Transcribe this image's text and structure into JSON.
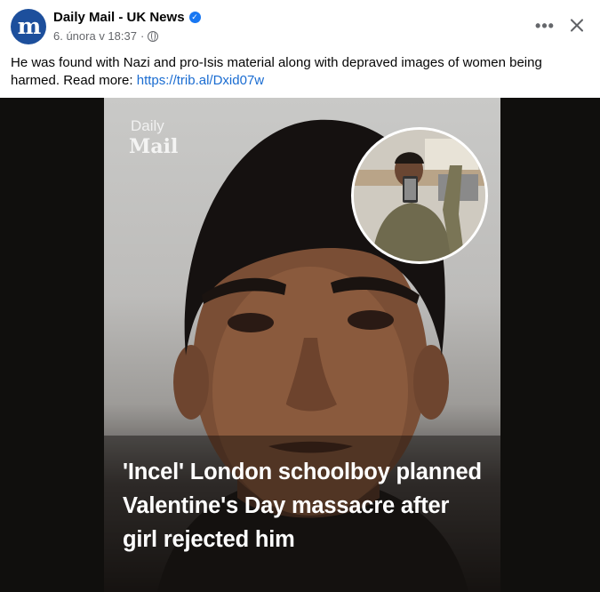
{
  "post": {
    "page_name": "Daily Mail - UK News",
    "avatar_letter": "m",
    "verified_symbol": "✓",
    "date": "6. února v 18:37",
    "separator": "·",
    "more_label": "•••",
    "text": "He was found with Nazi and pro-Isis material along with depraved images of women being harmed. Read more: ",
    "link": "https://trib.al/Dxid07w"
  },
  "media": {
    "watermark_line1": "Daily",
    "watermark_line2": "Mail",
    "headline": "'Incel' London schoolboy planned Valentine's Day massacre after girl rejected him"
  },
  "colors": {
    "link": "#1a6cd1",
    "verified": "#1877f2",
    "avatar": "#1d4f9c",
    "media_background": "#100f0d"
  }
}
